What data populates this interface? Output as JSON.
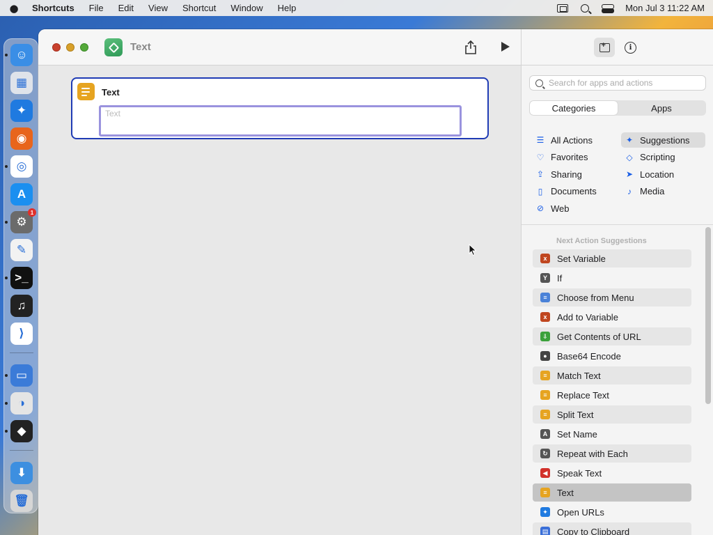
{
  "menubar": {
    "app_name": "Shortcuts",
    "items": [
      "File",
      "Edit",
      "View",
      "Shortcut",
      "Window",
      "Help"
    ],
    "clock": "Mon Jul 3  11:22 AM"
  },
  "dock": {
    "apps": [
      {
        "name": "finder-icon",
        "color": "#3a8ee6",
        "glyph": "☺"
      },
      {
        "name": "launchpad-icon",
        "color": "#dfe3ea",
        "glyph": "▦"
      },
      {
        "name": "safari-icon",
        "color": "#1f7ae0",
        "glyph": "✦"
      },
      {
        "name": "firefox-icon",
        "color": "#e8651c",
        "glyph": "◉"
      },
      {
        "name": "chrome-icon",
        "color": "#ffffff",
        "glyph": "◎"
      },
      {
        "name": "app-store-icon",
        "color": "#1b8ff0",
        "glyph": "A"
      },
      {
        "name": "system-settings-icon",
        "color": "#6b6b6b",
        "glyph": "⚙",
        "badge": "1"
      },
      {
        "name": "textedit-icon",
        "color": "#f2f2f2",
        "glyph": "✎"
      },
      {
        "name": "terminal-icon",
        "color": "#111111",
        "glyph": ">_"
      },
      {
        "name": "garageband-icon",
        "color": "#222222",
        "glyph": "♫"
      },
      {
        "name": "vscode-icon",
        "color": "#ffffff",
        "glyph": "⟩"
      },
      {
        "name": "image-capture-icon",
        "color": "#3b7bd8",
        "glyph": "▭"
      },
      {
        "name": "preview-icon",
        "color": "#e5e5e5",
        "glyph": "◑"
      },
      {
        "name": "shortcuts-icon",
        "color": "#222222",
        "glyph": "◆"
      },
      {
        "name": "downloads-folder-icon",
        "color": "#3d8fe0",
        "glyph": "⬇"
      },
      {
        "name": "trash-icon",
        "color": "#d6d6d6",
        "glyph": "🗑"
      }
    ]
  },
  "window": {
    "title": "Text",
    "action": {
      "title": "Text",
      "field_placeholder": "Text",
      "field_value": ""
    }
  },
  "sidebar": {
    "search_placeholder": "Search for apps and actions",
    "tabs": [
      "Categories",
      "Apps"
    ],
    "active_tab": "Categories",
    "categories_left": [
      {
        "label": "All Actions",
        "icon": "list-icon",
        "glyph": "☰"
      },
      {
        "label": "Favorites",
        "icon": "heart-icon",
        "glyph": "♡"
      },
      {
        "label": "Sharing",
        "icon": "share-icon",
        "glyph": "⇪"
      },
      {
        "label": "Documents",
        "icon": "document-icon",
        "glyph": "▯"
      },
      {
        "label": "Web",
        "icon": "compass-icon",
        "glyph": "⊘"
      }
    ],
    "categories_right": [
      {
        "label": "Suggestions",
        "icon": "sparkle-icon",
        "glyph": "✦",
        "selected": true
      },
      {
        "label": "Scripting",
        "icon": "scripting-icon",
        "glyph": "◇"
      },
      {
        "label": "Location",
        "icon": "location-icon",
        "glyph": "➤"
      },
      {
        "label": "Media",
        "icon": "music-note-icon",
        "glyph": "♪"
      }
    ],
    "suggestions_heading": "Next Action Suggestions",
    "suggestions": [
      {
        "label": "Set Variable",
        "icon": "variable-icon",
        "color": "#c0461f",
        "glyph": "x"
      },
      {
        "label": "If",
        "icon": "if-branch-icon",
        "color": "#555555",
        "glyph": "Y"
      },
      {
        "label": "Choose from Menu",
        "icon": "menu-icon",
        "color": "#4a82d8",
        "glyph": "≡"
      },
      {
        "label": "Add to Variable",
        "icon": "variable-icon",
        "color": "#c0461f",
        "glyph": "x"
      },
      {
        "label": "Get Contents of URL",
        "icon": "url-icon",
        "color": "#3aa13a",
        "glyph": "⇩"
      },
      {
        "label": "Base64 Encode",
        "icon": "encode-icon",
        "color": "#444444",
        "glyph": "●"
      },
      {
        "label": "Match Text",
        "icon": "text-icon",
        "color": "#e6a421",
        "glyph": "≡"
      },
      {
        "label": "Replace Text",
        "icon": "text-icon",
        "color": "#e6a421",
        "glyph": "≡"
      },
      {
        "label": "Split Text",
        "icon": "text-icon",
        "color": "#e6a421",
        "glyph": "≡"
      },
      {
        "label": "Set Name",
        "icon": "set-name-icon",
        "color": "#555555",
        "glyph": "A"
      },
      {
        "label": "Repeat with Each",
        "icon": "repeat-icon",
        "color": "#555555",
        "glyph": "↻"
      },
      {
        "label": "Speak Text",
        "icon": "speaker-icon",
        "color": "#d2302a",
        "glyph": "◀"
      },
      {
        "label": "Text",
        "icon": "text-icon",
        "color": "#e6a421",
        "glyph": "≡"
      },
      {
        "label": "Open URLs",
        "icon": "safari-icon",
        "color": "#1f7ae0",
        "glyph": "✦"
      },
      {
        "label": "Copy to Clipboard",
        "icon": "clipboard-icon",
        "color": "#3a6fd8",
        "glyph": "▤"
      }
    ]
  }
}
